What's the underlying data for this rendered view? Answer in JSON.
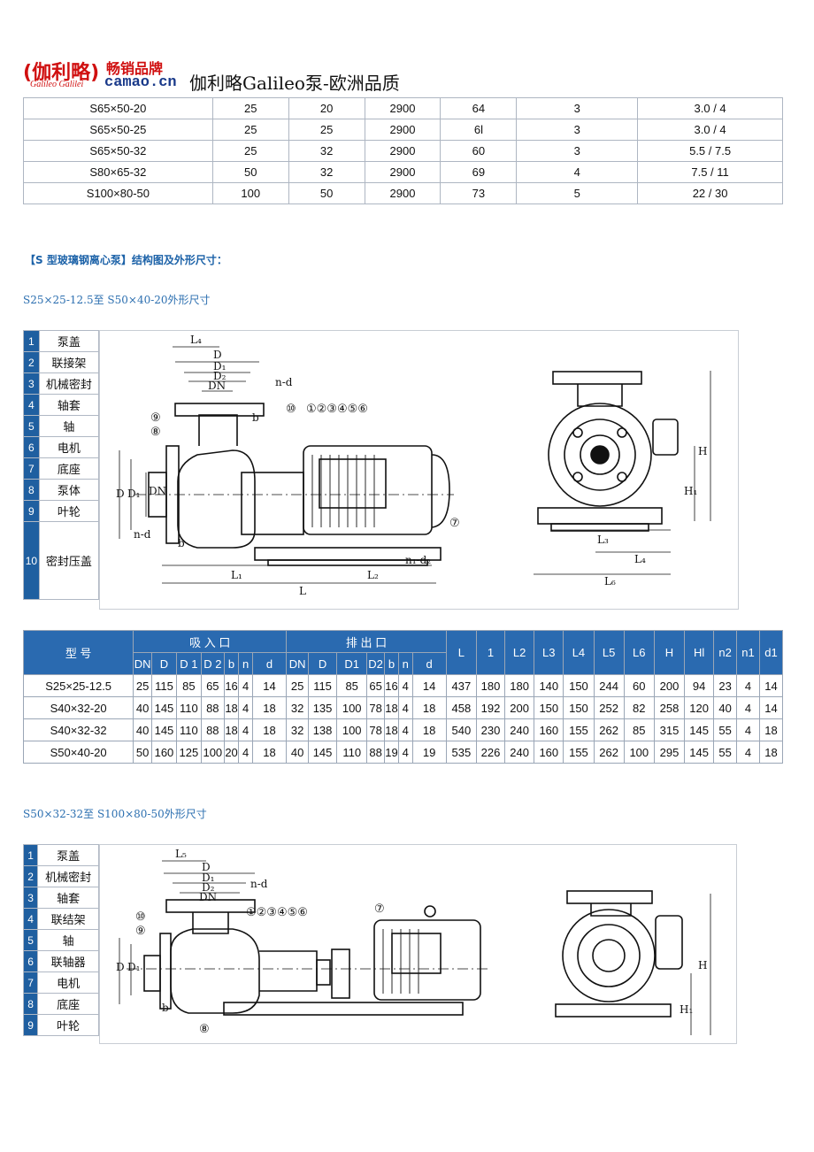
{
  "header": {
    "logo_main": "伽利略",
    "logo_sub": "Galileo Galilei",
    "logo_tag": "畅销品牌",
    "logo_url": "camao.cn",
    "title": "伽利略Galileo泵-欧洲品质"
  },
  "top_table": {
    "rows": [
      [
        "S65×50-20",
        "25",
        "20",
        "2900",
        "64",
        "3",
        "3.0 / 4"
      ],
      [
        "S65×50-25",
        "25",
        "25",
        "2900",
        "6l",
        "3",
        "3.0 / 4"
      ],
      [
        "S65×50-32",
        "25",
        "32",
        "2900",
        "60",
        "3",
        "5.5 / 7.5"
      ],
      [
        "S80×65-32",
        "50",
        "32",
        "2900",
        "69",
        "4",
        "7.5 / 11"
      ],
      [
        "S100×80-50",
        "100",
        "50",
        "2900",
        "73",
        "5",
        "22 / 30"
      ]
    ]
  },
  "section_title": "【S 型玻璃钢离心泵】结构图及外形尺寸：",
  "subtitle1": "S25×25-12.5至 S50×40-20外形尺寸",
  "parts1": [
    {
      "no": "1",
      "name": "泵盖"
    },
    {
      "no": "2",
      "name": "联接架"
    },
    {
      "no": "3",
      "name": "机械密封"
    },
    {
      "no": "4",
      "name": "轴套"
    },
    {
      "no": "5",
      "name": "轴"
    },
    {
      "no": "6",
      "name": "电机"
    },
    {
      "no": "7",
      "name": "底座"
    },
    {
      "no": "8",
      "name": "泵体"
    },
    {
      "no": "9",
      "name": "叶轮"
    },
    {
      "no": "10",
      "name": "密封压盖"
    }
  ],
  "drawing1_labels": {
    "l4": "L₄",
    "d": "D",
    "d1": "D₁",
    "d2": "D₂",
    "dn": "DN",
    "nd": "n-d",
    "b": "b",
    "callouts": "①②③④⑤⑥",
    "c10": "⑩",
    "c9": "⑨",
    "c8": "⑧",
    "c7": "⑦",
    "l1": "L₁",
    "l2": "L₂",
    "l": "L",
    "h1": "H₁",
    "h": "H",
    "l3": "L₃",
    "l6": "L₆",
    "n1d2": "n₁-d₂",
    "nd_left": "n-d"
  },
  "dims_table": {
    "model_header": "型 号",
    "inlet_header": "吸 入 口",
    "outlet_header": "排 出 口",
    "inlet_cols": [
      "DN",
      "D",
      "D 1",
      "D 2",
      "b",
      "n",
      "d"
    ],
    "outlet_cols": [
      "DN",
      "D",
      "D1",
      "D2",
      "b",
      "n",
      "d"
    ],
    "tail_cols": [
      "L",
      "1",
      "L2",
      "L3",
      "L4",
      "L5",
      "L6",
      "H",
      "Hl",
      "n2",
      "n1",
      "d1"
    ],
    "rows": [
      [
        "S25×25-12.5",
        "25",
        "115",
        "85",
        "65",
        "16",
        "4",
        "14",
        "25",
        "115",
        "85",
        "65",
        "16",
        "4",
        "14",
        "437",
        "180",
        "180",
        "140",
        "150",
        "244",
        "60",
        "200",
        "94",
        "23",
        "4",
        "14"
      ],
      [
        "S40×32-20",
        "40",
        "145",
        "110",
        "88",
        "18",
        "4",
        "18",
        "32",
        "135",
        "100",
        "78",
        "18",
        "4",
        "18",
        "458",
        "192",
        "200",
        "150",
        "150",
        "252",
        "82",
        "258",
        "120",
        "40",
        "4",
        "14"
      ],
      [
        "S40×32-32",
        "40",
        "145",
        "110",
        "88",
        "18",
        "4",
        "18",
        "32",
        "138",
        "100",
        "78",
        "18",
        "4",
        "18",
        "540",
        "230",
        "240",
        "160",
        "155",
        "262",
        "85",
        "315",
        "145",
        "55",
        "4",
        "18"
      ],
      [
        "S50×40-20",
        "50",
        "160",
        "125",
        "100",
        "20",
        "4",
        "18",
        "40",
        "145",
        "110",
        "88",
        "19",
        "4",
        "19",
        "535",
        "226",
        "240",
        "160",
        "155",
        "262",
        "100",
        "295",
        "145",
        "55",
        "4",
        "18"
      ]
    ]
  },
  "subtitle2": "S50×32-32至 S100×80-50外形尺寸",
  "parts2": [
    {
      "no": "1",
      "name": "泵盖"
    },
    {
      "no": "2",
      "name": "机械密封"
    },
    {
      "no": "3",
      "name": "轴套"
    },
    {
      "no": "4",
      "name": "联结架"
    },
    {
      "no": "5",
      "name": "轴"
    },
    {
      "no": "6",
      "name": "联轴器"
    },
    {
      "no": "7",
      "name": "电机"
    },
    {
      "no": "8",
      "name": "底座"
    },
    {
      "no": "9",
      "name": "叶轮"
    }
  ],
  "drawing2_labels": {
    "l5": "L₅",
    "d": "D",
    "d1": "D₁",
    "d2": "D₂",
    "dn": "DN",
    "nd": "n-d",
    "b": "b",
    "callouts": "①②③④⑤⑥",
    "c7": "⑦",
    "c10": "⑩",
    "c9": "⑨",
    "c8": "⑧",
    "h": "H",
    "h1": "H₁"
  }
}
